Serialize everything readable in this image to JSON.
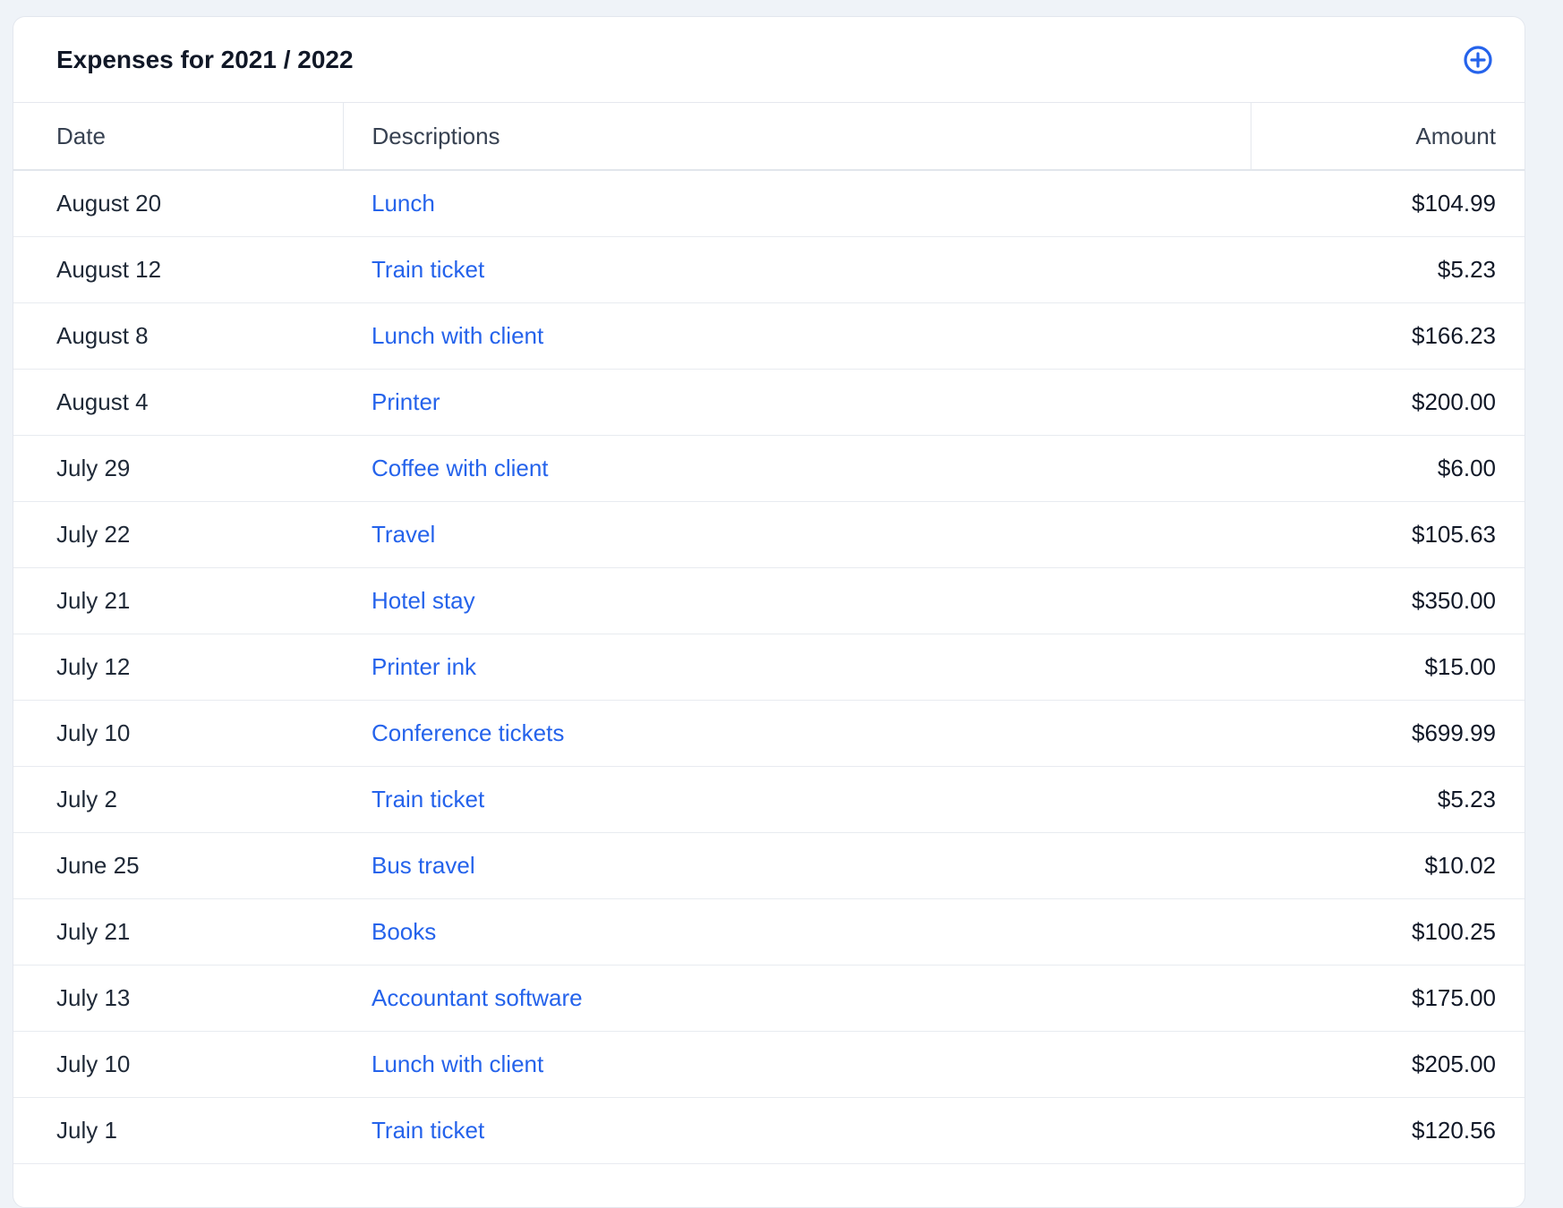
{
  "header": {
    "title": "Expenses for 2021 / 2022",
    "add_icon": "plus-circle-icon",
    "accent_color": "#2563eb"
  },
  "table": {
    "columns": [
      "Date",
      "Descriptions",
      "Amount"
    ],
    "rows": [
      {
        "date": "August 20",
        "description": "Lunch",
        "amount": "$104.99"
      },
      {
        "date": "August 12",
        "description": "Train ticket",
        "amount": "$5.23"
      },
      {
        "date": "August 8",
        "description": "Lunch with client",
        "amount": "$166.23"
      },
      {
        "date": "August 4",
        "description": "Printer",
        "amount": "$200.00"
      },
      {
        "date": "July 29",
        "description": "Coffee with client",
        "amount": "$6.00"
      },
      {
        "date": "July 22",
        "description": "Travel",
        "amount": "$105.63"
      },
      {
        "date": "July 21",
        "description": "Hotel stay",
        "amount": "$350.00"
      },
      {
        "date": "July 12",
        "description": "Printer ink",
        "amount": "$15.00"
      },
      {
        "date": "July 10",
        "description": "Conference tickets",
        "amount": "$699.99"
      },
      {
        "date": "July 2",
        "description": "Train ticket",
        "amount": "$5.23"
      },
      {
        "date": "June 25",
        "description": "Bus travel",
        "amount": "$10.02"
      },
      {
        "date": "July 21",
        "description": "Books",
        "amount": "$100.25"
      },
      {
        "date": "July 13",
        "description": "Accountant software",
        "amount": "$175.00"
      },
      {
        "date": "July 10",
        "description": "Lunch with client",
        "amount": "$205.00"
      },
      {
        "date": "July 1",
        "description": "Train ticket",
        "amount": "$120.56"
      }
    ]
  }
}
